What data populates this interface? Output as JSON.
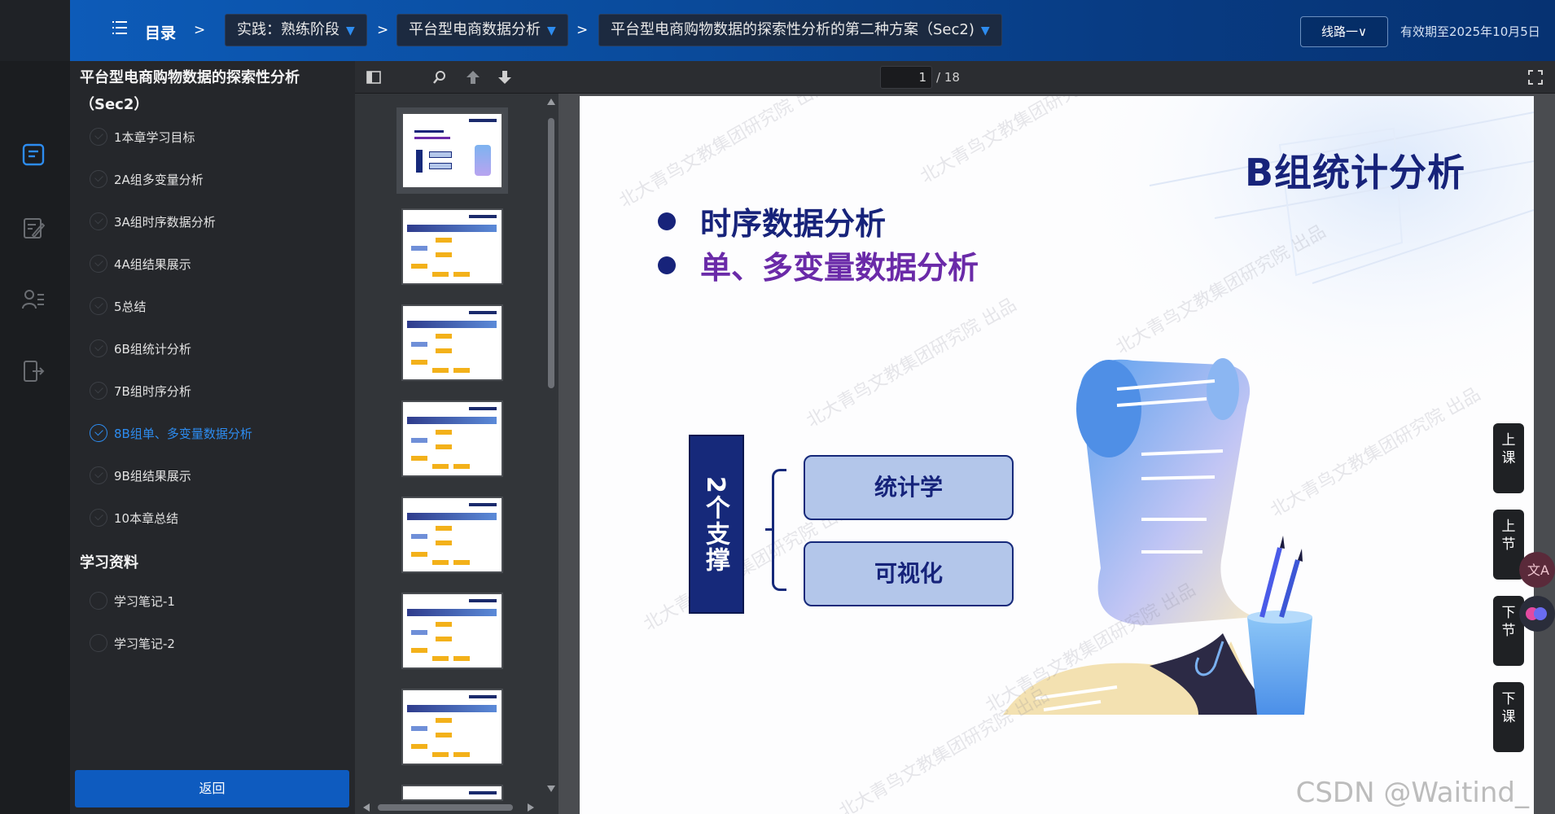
{
  "topbar": {
    "toc_label": "目录",
    "sep": ">",
    "crumbs": [
      "实践：熟练阶段",
      "平台型电商数据分析",
      "平台型电商购物数据的探索性分析的第二种方案（Sec2)"
    ],
    "route_button": "线路一∨",
    "valid_until": "有效期至2025年10月5日"
  },
  "sidebar": {
    "title": "平台型电商购物数据的探索性分析（Sec2）",
    "chapters": [
      {
        "label": "1本章学习目标"
      },
      {
        "label": "2A组多变量分析"
      },
      {
        "label": "3A组时序数据分析"
      },
      {
        "label": "4A组结果展示"
      },
      {
        "label": "5总结"
      },
      {
        "label": "6B组统计分析"
      },
      {
        "label": "7B组时序分析"
      },
      {
        "label": "8B组单、多变量数据分析"
      },
      {
        "label": "9B组结果展示"
      },
      {
        "label": "10本章总结"
      }
    ],
    "materials_heading": "学习资料",
    "materials": [
      {
        "label": "学习笔记-1"
      },
      {
        "label": "学习笔记-2"
      }
    ],
    "back_button": "返回"
  },
  "viewer": {
    "page_current": "1",
    "page_total": "/ 18"
  },
  "slide": {
    "title": "B组统计分析",
    "bullet1": "时序数据分析",
    "bullet2": "单、多变量数据分析",
    "support_label": "2个支撑",
    "pill1": "统计学",
    "pill2": "可视化",
    "watermark": "北大青鸟文教集团研究院 出品",
    "credit": "CSDN @Waitind_"
  },
  "float_buttons": {
    "prev_lesson": "上课",
    "prev_section": "上节",
    "next_section": "下节",
    "next_lesson": "下课"
  },
  "colors": {
    "accent": "#2d8cf0",
    "topbar_blue": "#0d5bb8",
    "slide_navy": "#17237a",
    "slide_purple": "#6a2aa8"
  }
}
